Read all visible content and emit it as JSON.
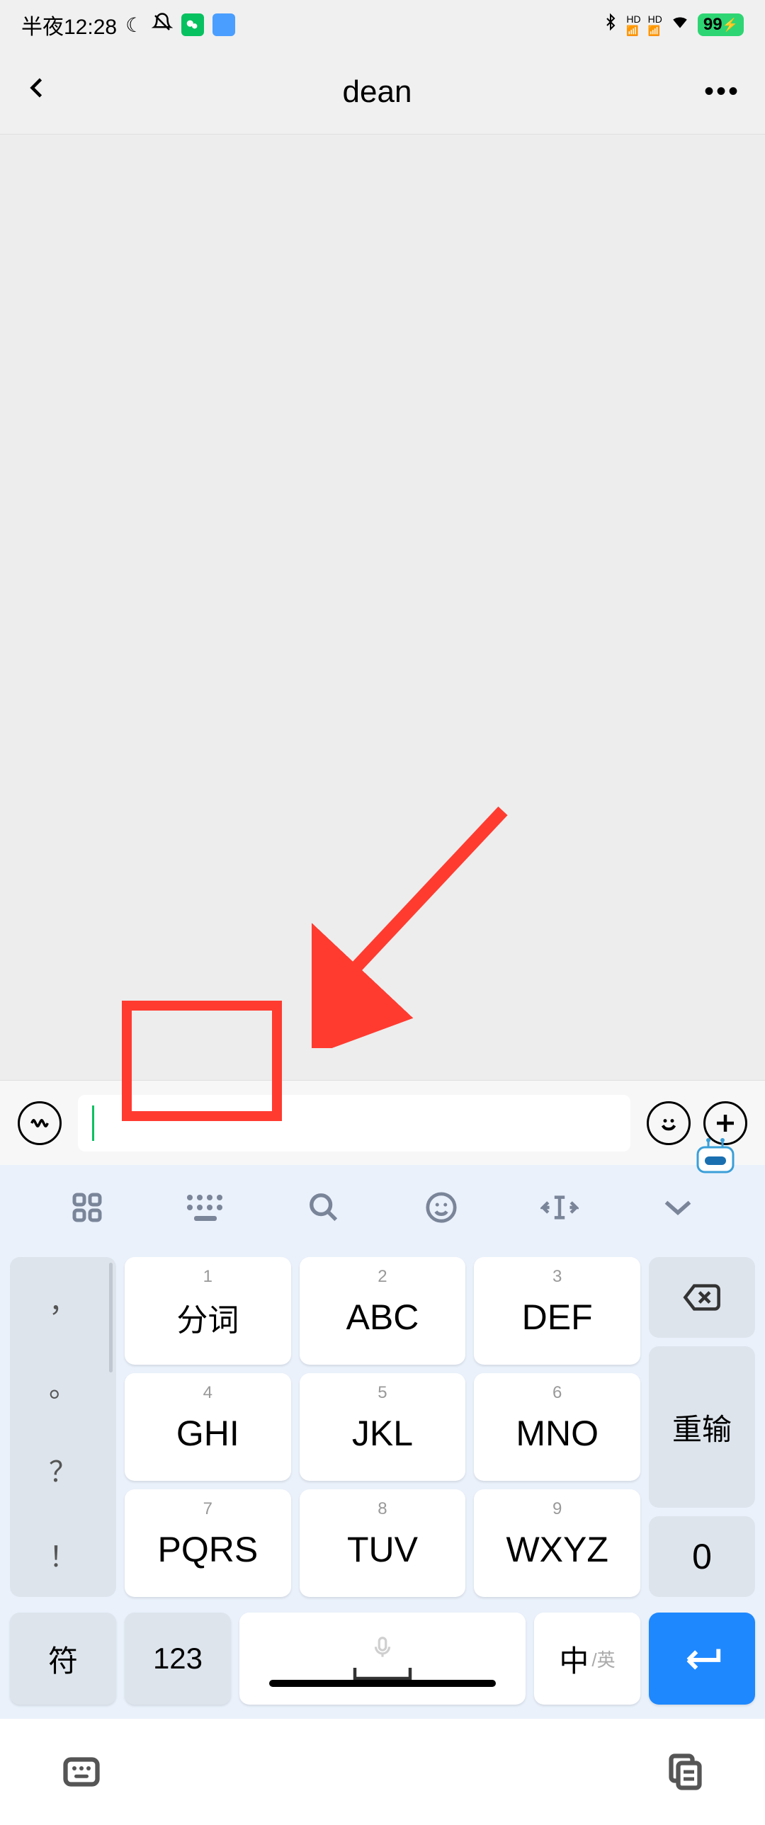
{
  "status": {
    "time": "半夜12:28",
    "battery": "99"
  },
  "header": {
    "title": "dean"
  },
  "keyboard": {
    "keys": [
      {
        "num": "1",
        "label": "分词"
      },
      {
        "num": "2",
        "label": "ABC"
      },
      {
        "num": "3",
        "label": "DEF"
      },
      {
        "num": "4",
        "label": "GHI"
      },
      {
        "num": "5",
        "label": "JKL"
      },
      {
        "num": "6",
        "label": "MNO"
      },
      {
        "num": "7",
        "label": "PQRS"
      },
      {
        "num": "8",
        "label": "TUV"
      },
      {
        "num": "9",
        "label": "WXYZ"
      }
    ],
    "punctuation": [
      "，",
      "。",
      "？",
      "！"
    ],
    "retype": "重输",
    "zero": "0",
    "symbol": "符",
    "numbers": "123",
    "lang_main": "中",
    "lang_sub": "/英"
  }
}
